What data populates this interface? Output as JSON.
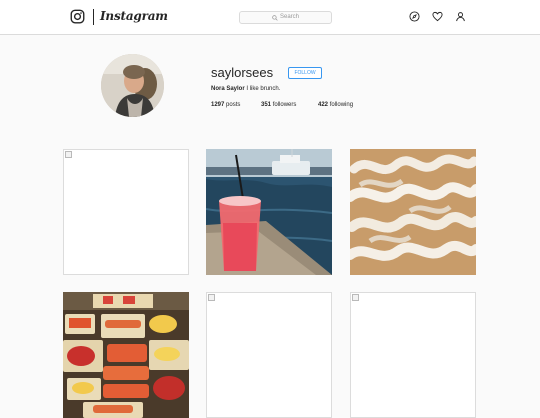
{
  "header": {
    "wordmark": "Instagram",
    "search_placeholder": "Search",
    "icons": [
      "instagram-glyph-icon",
      "compass-icon",
      "heart-icon",
      "person-icon"
    ]
  },
  "profile": {
    "username": "saylorsees",
    "follow_label": "FOLLOW",
    "full_name": "Nora Saylor",
    "bio": "I like brunch.",
    "stats": [
      {
        "count": "1297",
        "label": "posts"
      },
      {
        "count": "351",
        "label": "followers"
      },
      {
        "count": "422",
        "label": "following"
      }
    ]
  },
  "colors": {
    "accent": "#3897f0",
    "border": "#dbdbdb",
    "background": "#fafafa"
  },
  "posts": [
    {
      "kind": "broken-image"
    },
    {
      "kind": "photo",
      "subject": "pink drink in plastic cup on dock with boats"
    },
    {
      "kind": "photo",
      "subject": "funnel cake with powdered sugar"
    },
    {
      "kind": "photo",
      "subject": "lobster rolls and corn on trays"
    },
    {
      "kind": "broken-image"
    },
    {
      "kind": "broken-image"
    }
  ]
}
